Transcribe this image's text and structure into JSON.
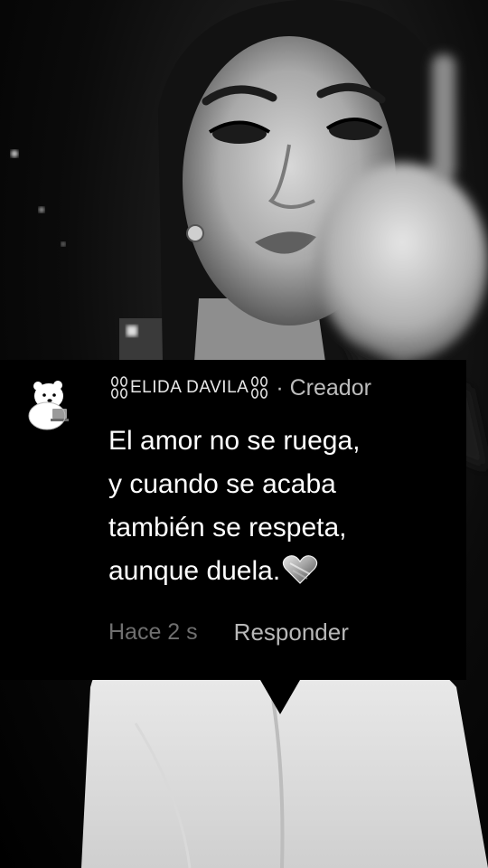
{
  "comment": {
    "username": "ELIDA DAVILA",
    "creator_label": "· Creador",
    "text_lines": [
      "El amor no se ruega,",
      "y cuando se acaba",
      "también se respeta,",
      "aunque duela."
    ],
    "timestamp": "Hace 2 s",
    "reply_label": "Responder"
  },
  "icons": {
    "avatar": "polar-bear-avatar",
    "username_decoration": "chain-link-icon",
    "emoji": "heart-icon"
  },
  "colors": {
    "background": "#000000",
    "text_primary": "#ffffff",
    "text_secondary": "#bdbdbd",
    "timestamp": "#6f6f6f"
  }
}
